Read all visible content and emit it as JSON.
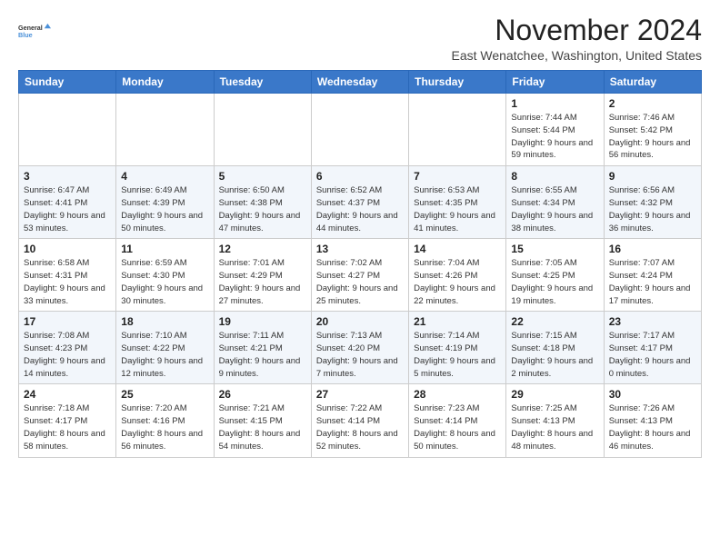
{
  "logo": {
    "line1": "General",
    "line2": "Blue"
  },
  "title": "November 2024",
  "location": "East Wenatchee, Washington, United States",
  "header": {
    "days": [
      "Sunday",
      "Monday",
      "Tuesday",
      "Wednesday",
      "Thursday",
      "Friday",
      "Saturday"
    ]
  },
  "weeks": [
    [
      {
        "day": "",
        "info": ""
      },
      {
        "day": "",
        "info": ""
      },
      {
        "day": "",
        "info": ""
      },
      {
        "day": "",
        "info": ""
      },
      {
        "day": "",
        "info": ""
      },
      {
        "day": "1",
        "info": "Sunrise: 7:44 AM\nSunset: 5:44 PM\nDaylight: 9 hours and 59 minutes."
      },
      {
        "day": "2",
        "info": "Sunrise: 7:46 AM\nSunset: 5:42 PM\nDaylight: 9 hours and 56 minutes."
      }
    ],
    [
      {
        "day": "3",
        "info": "Sunrise: 6:47 AM\nSunset: 4:41 PM\nDaylight: 9 hours and 53 minutes."
      },
      {
        "day": "4",
        "info": "Sunrise: 6:49 AM\nSunset: 4:39 PM\nDaylight: 9 hours and 50 minutes."
      },
      {
        "day": "5",
        "info": "Sunrise: 6:50 AM\nSunset: 4:38 PM\nDaylight: 9 hours and 47 minutes."
      },
      {
        "day": "6",
        "info": "Sunrise: 6:52 AM\nSunset: 4:37 PM\nDaylight: 9 hours and 44 minutes."
      },
      {
        "day": "7",
        "info": "Sunrise: 6:53 AM\nSunset: 4:35 PM\nDaylight: 9 hours and 41 minutes."
      },
      {
        "day": "8",
        "info": "Sunrise: 6:55 AM\nSunset: 4:34 PM\nDaylight: 9 hours and 38 minutes."
      },
      {
        "day": "9",
        "info": "Sunrise: 6:56 AM\nSunset: 4:32 PM\nDaylight: 9 hours and 36 minutes."
      }
    ],
    [
      {
        "day": "10",
        "info": "Sunrise: 6:58 AM\nSunset: 4:31 PM\nDaylight: 9 hours and 33 minutes."
      },
      {
        "day": "11",
        "info": "Sunrise: 6:59 AM\nSunset: 4:30 PM\nDaylight: 9 hours and 30 minutes."
      },
      {
        "day": "12",
        "info": "Sunrise: 7:01 AM\nSunset: 4:29 PM\nDaylight: 9 hours and 27 minutes."
      },
      {
        "day": "13",
        "info": "Sunrise: 7:02 AM\nSunset: 4:27 PM\nDaylight: 9 hours and 25 minutes."
      },
      {
        "day": "14",
        "info": "Sunrise: 7:04 AM\nSunset: 4:26 PM\nDaylight: 9 hours and 22 minutes."
      },
      {
        "day": "15",
        "info": "Sunrise: 7:05 AM\nSunset: 4:25 PM\nDaylight: 9 hours and 19 minutes."
      },
      {
        "day": "16",
        "info": "Sunrise: 7:07 AM\nSunset: 4:24 PM\nDaylight: 9 hours and 17 minutes."
      }
    ],
    [
      {
        "day": "17",
        "info": "Sunrise: 7:08 AM\nSunset: 4:23 PM\nDaylight: 9 hours and 14 minutes."
      },
      {
        "day": "18",
        "info": "Sunrise: 7:10 AM\nSunset: 4:22 PM\nDaylight: 9 hours and 12 minutes."
      },
      {
        "day": "19",
        "info": "Sunrise: 7:11 AM\nSunset: 4:21 PM\nDaylight: 9 hours and 9 minutes."
      },
      {
        "day": "20",
        "info": "Sunrise: 7:13 AM\nSunset: 4:20 PM\nDaylight: 9 hours and 7 minutes."
      },
      {
        "day": "21",
        "info": "Sunrise: 7:14 AM\nSunset: 4:19 PM\nDaylight: 9 hours and 5 minutes."
      },
      {
        "day": "22",
        "info": "Sunrise: 7:15 AM\nSunset: 4:18 PM\nDaylight: 9 hours and 2 minutes."
      },
      {
        "day": "23",
        "info": "Sunrise: 7:17 AM\nSunset: 4:17 PM\nDaylight: 9 hours and 0 minutes."
      }
    ],
    [
      {
        "day": "24",
        "info": "Sunrise: 7:18 AM\nSunset: 4:17 PM\nDaylight: 8 hours and 58 minutes."
      },
      {
        "day": "25",
        "info": "Sunrise: 7:20 AM\nSunset: 4:16 PM\nDaylight: 8 hours and 56 minutes."
      },
      {
        "day": "26",
        "info": "Sunrise: 7:21 AM\nSunset: 4:15 PM\nDaylight: 8 hours and 54 minutes."
      },
      {
        "day": "27",
        "info": "Sunrise: 7:22 AM\nSunset: 4:14 PM\nDaylight: 8 hours and 52 minutes."
      },
      {
        "day": "28",
        "info": "Sunrise: 7:23 AM\nSunset: 4:14 PM\nDaylight: 8 hours and 50 minutes."
      },
      {
        "day": "29",
        "info": "Sunrise: 7:25 AM\nSunset: 4:13 PM\nDaylight: 8 hours and 48 minutes."
      },
      {
        "day": "30",
        "info": "Sunrise: 7:26 AM\nSunset: 4:13 PM\nDaylight: 8 hours and 46 minutes."
      }
    ]
  ]
}
